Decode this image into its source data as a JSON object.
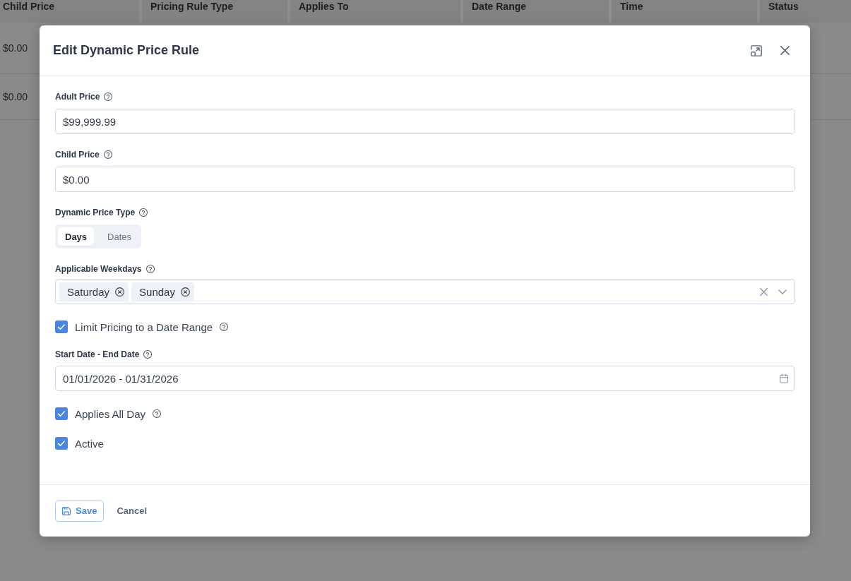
{
  "background_table": {
    "columns": [
      "Child Price",
      "Pricing Rule Type",
      "Applies To",
      "Date Range",
      "Time",
      "Status"
    ],
    "rows": [
      {
        "cells": [
          "$0.00"
        ]
      },
      {
        "cells": [
          "$0.00"
        ]
      }
    ]
  },
  "dialog": {
    "title": "Edit Dynamic Price Rule",
    "fields": [
      {
        "kind": "text",
        "label": "Adult Price",
        "help": true,
        "value": "$99,999.99"
      },
      {
        "kind": "text",
        "label": "Child Price",
        "help": true,
        "value": "$0.00"
      },
      {
        "kind": "segmented",
        "label": "Dynamic Price Type",
        "help": true,
        "options": [
          {
            "label": "Days",
            "selected": true
          },
          {
            "label": "Dates",
            "selected": false
          }
        ]
      },
      {
        "kind": "multiselect",
        "label": "Applicable Weekdays",
        "help": true,
        "tags": [
          "Saturday",
          "Sunday"
        ]
      },
      {
        "kind": "checkbox",
        "label": "Limit Pricing to a Date Range",
        "help": true,
        "checked": true
      },
      {
        "kind": "daterange",
        "label": "Start Date - End Date",
        "help": true,
        "value": "01/01/2026 - 01/31/2026"
      },
      {
        "kind": "checkbox",
        "label": "Applies All Day",
        "help": true,
        "checked": true
      },
      {
        "kind": "checkbox",
        "label": "Active",
        "help": false,
        "checked": true
      }
    ],
    "buttons": [
      {
        "kind": "primary",
        "label": "Save"
      },
      {
        "kind": "secondary",
        "label": "Cancel"
      }
    ]
  }
}
